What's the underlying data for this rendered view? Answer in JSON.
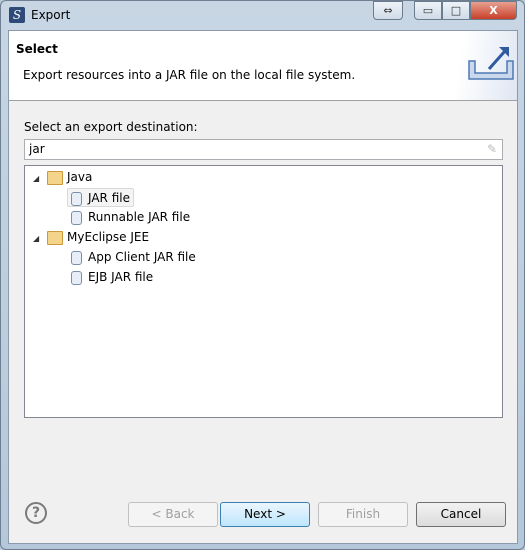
{
  "window": {
    "title": "Export"
  },
  "header": {
    "title": "Select",
    "description": "Export resources into a JAR file on the local file system."
  },
  "filter": {
    "label": "Select an export destination:",
    "value": "jar"
  },
  "tree": [
    {
      "label": "Java",
      "items": [
        {
          "label": "JAR file",
          "selected": true
        },
        {
          "label": "Runnable JAR file"
        }
      ]
    },
    {
      "label": "MyEclipse JEE",
      "items": [
        {
          "label": "App Client JAR file"
        },
        {
          "label": "EJB JAR file"
        }
      ]
    }
  ],
  "buttons": {
    "back": "< Back",
    "next": "Next >",
    "finish": "Finish",
    "cancel": "Cancel",
    "help": "?"
  },
  "titlebar": {
    "resize": "⇔",
    "minimize": "▭",
    "maximize": "□",
    "close": "X"
  }
}
